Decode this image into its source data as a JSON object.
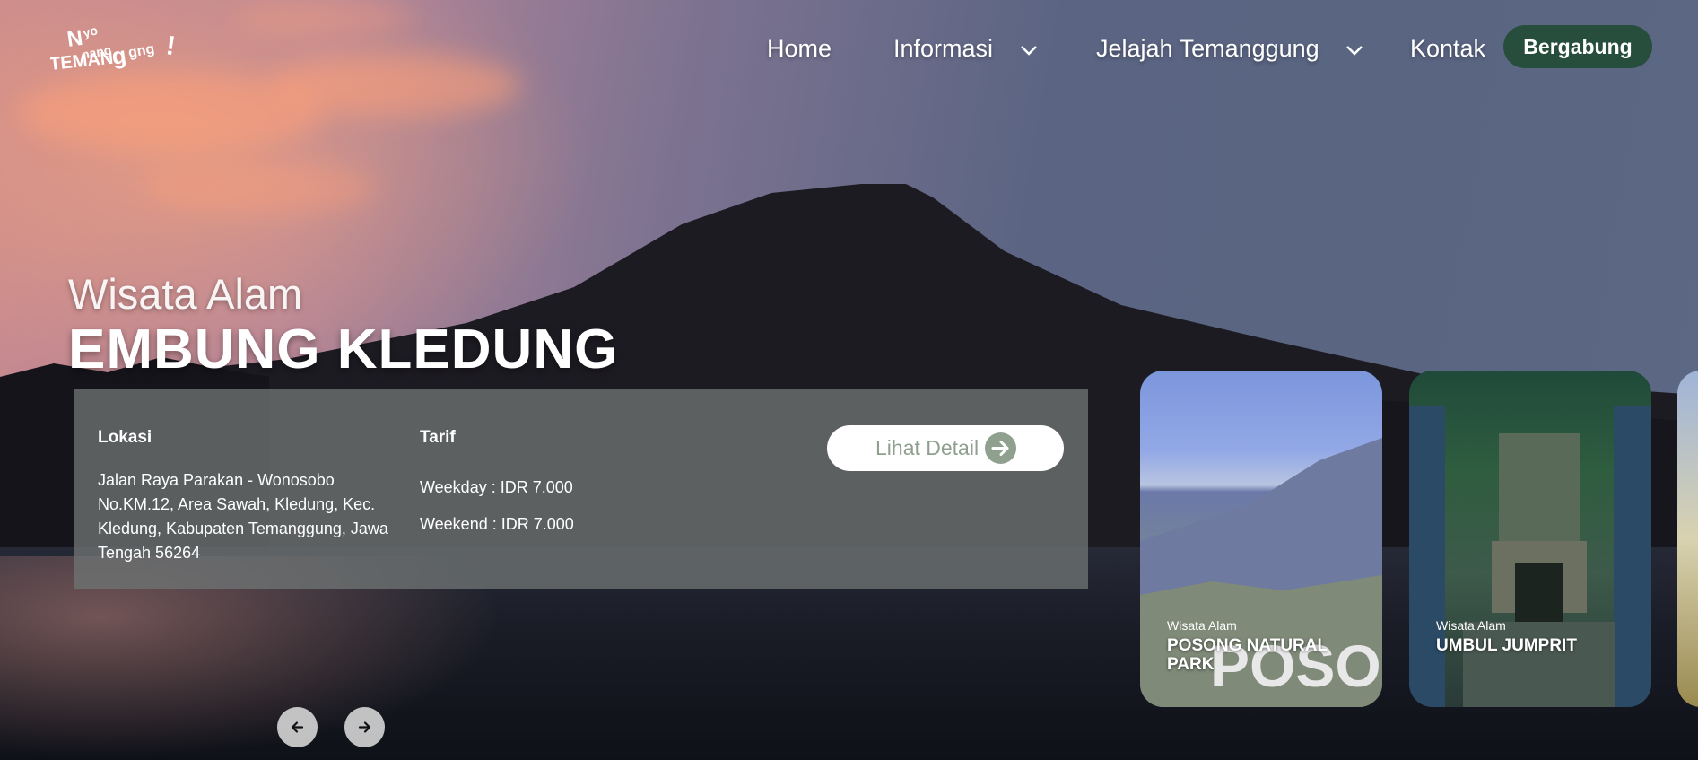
{
  "logo": {
    "text": "Nyo Nang Temanggung!"
  },
  "nav": {
    "items": [
      {
        "label": "Home"
      },
      {
        "label": "Informasi"
      },
      {
        "label": "Jelajah Temanggung"
      },
      {
        "label": "Kontak"
      }
    ],
    "join_label": "Bergabung"
  },
  "hero": {
    "category": "Wisata Alam",
    "title": "EMBUNG KLEDUNG"
  },
  "info": {
    "location_label": "Lokasi",
    "location_lines": [
      "Jalan Raya Parakan - Wonosobo",
      "No.KM.12, Area Sawah, Kledung, Kec.",
      "Kledung, Kabupaten Temanggung, Jawa",
      "Tengah 56264"
    ],
    "tariff_label": "Tarif",
    "weekday": "Weekday : IDR 7.000",
    "weekend": "Weekend : IDR 7.000",
    "detail_button": "Lihat Detail"
  },
  "cards": [
    {
      "category": "Wisata Alam",
      "name": "POSONG NATURAL PARK",
      "sign_text": "POSON"
    },
    {
      "category": "Wisata Alam",
      "name": "UMBUL JUMPRIT"
    }
  ],
  "colors": {
    "join_bg": "#274d3d",
    "detail_text": "#8fa08f",
    "panel_bg": "rgba(110,115,115,0.78)"
  }
}
